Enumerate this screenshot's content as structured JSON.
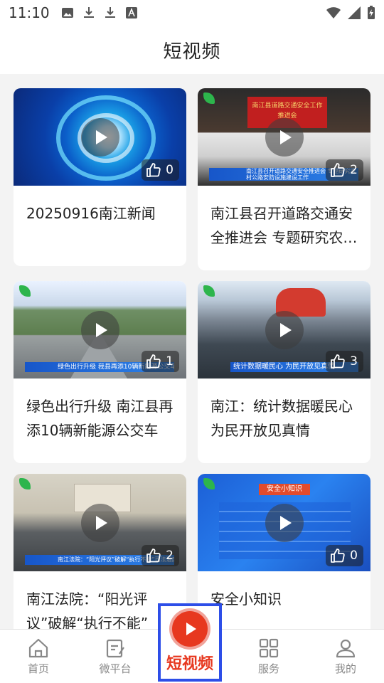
{
  "status_bar": {
    "time": "11:10",
    "left_icons": [
      "image-icon",
      "download-icon",
      "download-icon",
      "font-icon"
    ],
    "right_icons": [
      "wifi-icon",
      "signal-icon",
      "battery-icon"
    ]
  },
  "header": {
    "title": "短视频"
  },
  "videos": [
    {
      "title": "20250916南江新闻",
      "likes": "0",
      "thumb_icon": "news-intro-thumbnail"
    },
    {
      "title": "南江县召开道路交通安全推进会 专题研究农村公路安防设施建设工作",
      "likes": "2",
      "thumb_icon": "meeting-thumbnail",
      "banner_text": "南江县道路交通安全工作推进会",
      "caption": "南江县召开道路交通安全推进会 专题研究农村公路安防设施建设工作"
    },
    {
      "title": "绿色出行升级 南江县再添10辆新能源公交车",
      "likes": "1",
      "thumb_icon": "road-thumbnail",
      "caption": "绿色出行升级 我县再添10辆新能源公交车"
    },
    {
      "title": "南江：统计数据暖民心 为民开放见真情",
      "likes": "3",
      "thumb_icon": "crowd-thumbnail",
      "caption": "统计数据暖民心 为民开放见真情"
    },
    {
      "title": "南江法院：“阳光评议”破解“执行不能”",
      "likes": "2",
      "thumb_icon": "court-meeting-thumbnail",
      "caption": "南江法院：“阳光评议”破解“执行不能”司法温度"
    },
    {
      "title": "安全小知识",
      "likes": "0",
      "thumb_icon": "safety-tips-thumbnail",
      "banner_text": "安全小知识"
    }
  ],
  "bottom_nav": {
    "items": [
      {
        "label": "首页",
        "icon": "home-icon"
      },
      {
        "label": "微平台",
        "icon": "edit-icon"
      },
      {
        "label": "短视频",
        "icon": "play-icon",
        "active": true
      },
      {
        "label": "服务",
        "icon": "grid-icon"
      },
      {
        "label": "我的",
        "icon": "user-icon"
      }
    ]
  },
  "colors": {
    "accent": "#e7381f",
    "highlight": "#2d4ee8",
    "background": "#f3f3f3"
  }
}
